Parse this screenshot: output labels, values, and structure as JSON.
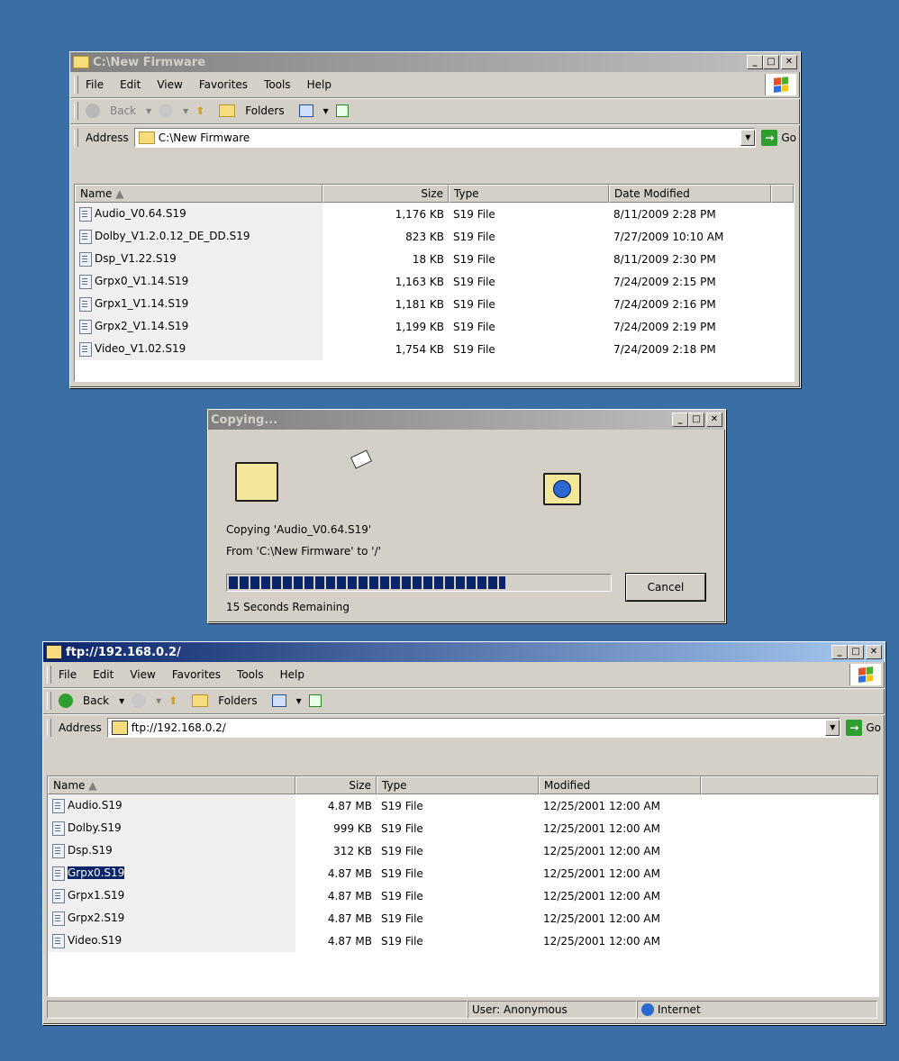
{
  "win1": {
    "title": "C:\\New Firmware",
    "menu": [
      "File",
      "Edit",
      "View",
      "Favorites",
      "Tools",
      "Help"
    ],
    "toolbar": {
      "back": "Back",
      "folders": "Folders"
    },
    "address_label": "Address",
    "address_value": "C:\\New Firmware",
    "go_label": "Go",
    "columns": [
      "Name",
      "Size",
      "Type",
      "Date Modified"
    ],
    "rows": [
      {
        "name": "Audio_V0.64.S19",
        "size": "1,176 KB",
        "type": "S19 File",
        "date": "8/11/2009 2:28 PM"
      },
      {
        "name": "Dolby_V1.2.0.12_DE_DD.S19",
        "size": "823 KB",
        "type": "S19 File",
        "date": "7/27/2009 10:10 AM"
      },
      {
        "name": "Dsp_V1.22.S19",
        "size": "18 KB",
        "type": "S19 File",
        "date": "8/11/2009 2:30 PM"
      },
      {
        "name": "Grpx0_V1.14.S19",
        "size": "1,163 KB",
        "type": "S19 File",
        "date": "7/24/2009 2:15 PM"
      },
      {
        "name": "Grpx1_V1.14.S19",
        "size": "1,181 KB",
        "type": "S19 File",
        "date": "7/24/2009 2:16 PM"
      },
      {
        "name": "Grpx2_V1.14.S19",
        "size": "1,199 KB",
        "type": "S19 File",
        "date": "7/24/2009 2:19 PM"
      },
      {
        "name": "Video_V1.02.S19",
        "size": "1,754 KB",
        "type": "S19 File",
        "date": "7/24/2009 2:18 PM"
      }
    ]
  },
  "copy": {
    "title": "Copying...",
    "line1": "Copying 'Audio_V0.64.S19'",
    "line2": "From 'C:\\New Firmware' to '/'",
    "progress": 0.72,
    "remaining": "15 Seconds Remaining",
    "cancel": "Cancel"
  },
  "win2": {
    "title": "ftp://192.168.0.2/",
    "menu": [
      "File",
      "Edit",
      "View",
      "Favorites",
      "Tools",
      "Help"
    ],
    "toolbar": {
      "back": "Back",
      "folders": "Folders"
    },
    "address_label": "Address",
    "address_value": "ftp://192.168.0.2/",
    "go_label": "Go",
    "columns": [
      "Name",
      "Size",
      "Type",
      "Modified"
    ],
    "rows": [
      {
        "name": "Audio.S19",
        "size": "4.87 MB",
        "type": "S19 File",
        "date": "12/25/2001 12:00 AM"
      },
      {
        "name": "Dolby.S19",
        "size": "999 KB",
        "type": "S19 File",
        "date": "12/25/2001 12:00 AM"
      },
      {
        "name": "Dsp.S19",
        "size": "312 KB",
        "type": "S19 File",
        "date": "12/25/2001 12:00 AM"
      },
      {
        "name": "Grpx0.S19",
        "size": "4.87 MB",
        "type": "S19 File",
        "date": "12/25/2001 12:00 AM"
      },
      {
        "name": "Grpx1.S19",
        "size": "4.87 MB",
        "type": "S19 File",
        "date": "12/25/2001 12:00 AM"
      },
      {
        "name": "Grpx2.S19",
        "size": "4.87 MB",
        "type": "S19 File",
        "date": "12/25/2001 12:00 AM"
      },
      {
        "name": "Video.S19",
        "size": "4.87 MB",
        "type": "S19 File",
        "date": "12/25/2001 12:00 AM"
      }
    ],
    "status_user": "User: Anonymous",
    "status_zone": "Internet"
  }
}
